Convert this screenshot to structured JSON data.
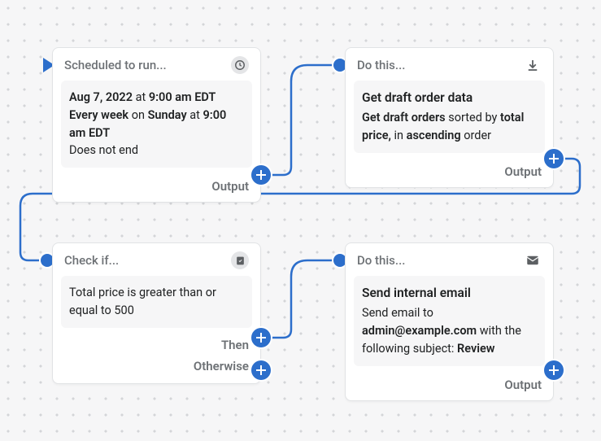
{
  "nodes": {
    "trigger": {
      "header": "Scheduled to run...",
      "start_date": "Aug 7, 2022",
      "at1": " at ",
      "time1": "9:00 am EDT",
      "freq": "Every week",
      "on_txt": " on ",
      "day": "Sunday",
      "at2": " at ",
      "time2": "9:00 am EDT",
      "end_text": "Does not end",
      "output": "Output"
    },
    "action1": {
      "header": "Do this...",
      "title": "Get draft order data",
      "l1a": "Get draft orders",
      "l1b": " sorted by ",
      "l1c": "total price,",
      "l1d": " in ",
      "l1e": "ascending",
      "l1f": " order",
      "output": "Output"
    },
    "cond": {
      "header": "Check if...",
      "text": "Total price is greater than or equal to 500",
      "then": "Then",
      "otherwise": "Otherwise"
    },
    "action2": {
      "header": "Do this...",
      "title": "Send internal email",
      "l1": "Send email to ",
      "email": "admin@example.com",
      "l2": " with the following subject: ",
      "subj": "Review",
      "output": "Output"
    }
  }
}
